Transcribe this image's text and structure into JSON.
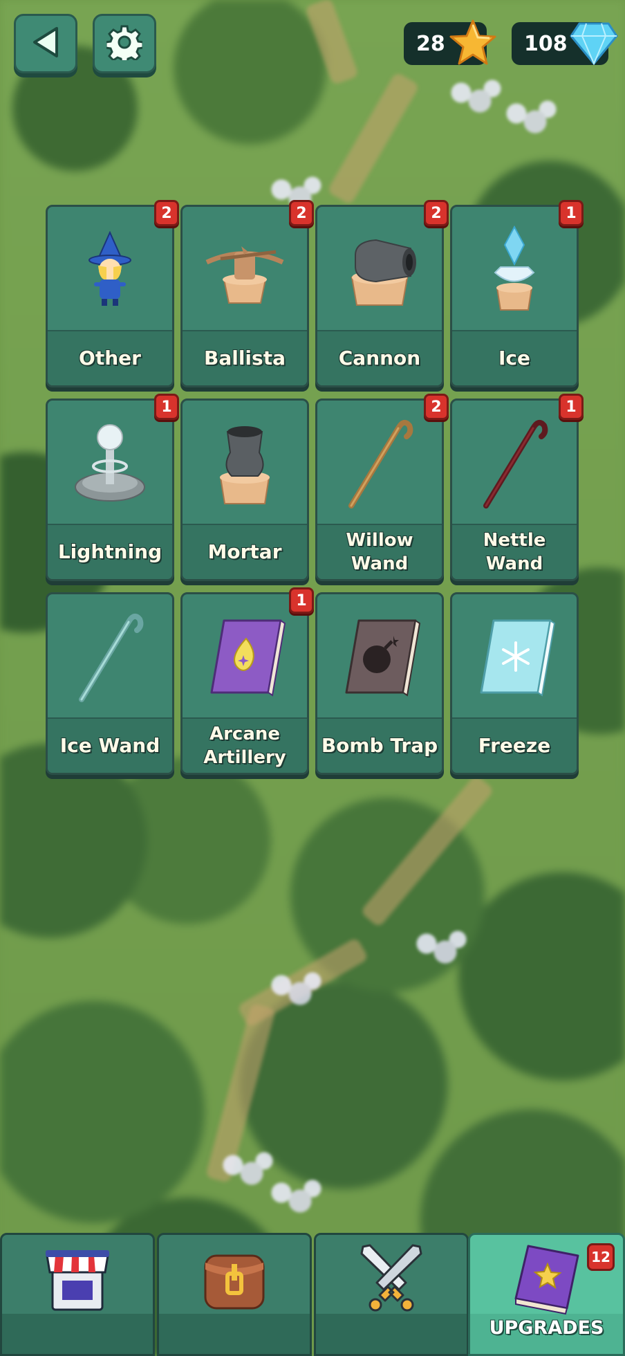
{
  "header": {
    "back_icon": "back-arrow-icon",
    "settings_icon": "gear-icon",
    "stars": "28",
    "star_icon": "star-icon",
    "gems": "108",
    "gem_icon": "diamond-icon"
  },
  "cards": [
    {
      "name": "Other",
      "badge": "2",
      "icon": "wizard-icon"
    },
    {
      "name": "Ballista",
      "badge": "2",
      "icon": "ballista-icon"
    },
    {
      "name": "Cannon",
      "badge": "2",
      "icon": "cannon-icon"
    },
    {
      "name": "Ice",
      "badge": "1",
      "icon": "ice-tower-icon"
    },
    {
      "name": "Lightning",
      "badge": "1",
      "icon": "lightning-tower-icon"
    },
    {
      "name": "Mortar",
      "badge": "",
      "icon": "mortar-icon"
    },
    {
      "name": "Willow Wand",
      "badge": "2",
      "icon": "willow-wand-icon"
    },
    {
      "name": "Nettle Wand",
      "badge": "1",
      "icon": "nettle-wand-icon"
    },
    {
      "name": "Ice Wand",
      "badge": "",
      "icon": "ice-wand-icon"
    },
    {
      "name": "Arcane Artillery",
      "badge": "1",
      "icon": "arcane-spellbook-icon"
    },
    {
      "name": "Bomb Trap",
      "badge": "",
      "icon": "bomb-spellbook-icon"
    },
    {
      "name": "Freeze",
      "badge": "",
      "icon": "freeze-spellbook-icon"
    }
  ],
  "nav": {
    "shop_icon": "shop-icon",
    "inventory_icon": "backpack-icon",
    "battle_icon": "crossed-swords-icon",
    "upgrades_icon": "spellbook-icon",
    "upgrades_label": "UPGRADES",
    "upgrades_badge": "12"
  }
}
